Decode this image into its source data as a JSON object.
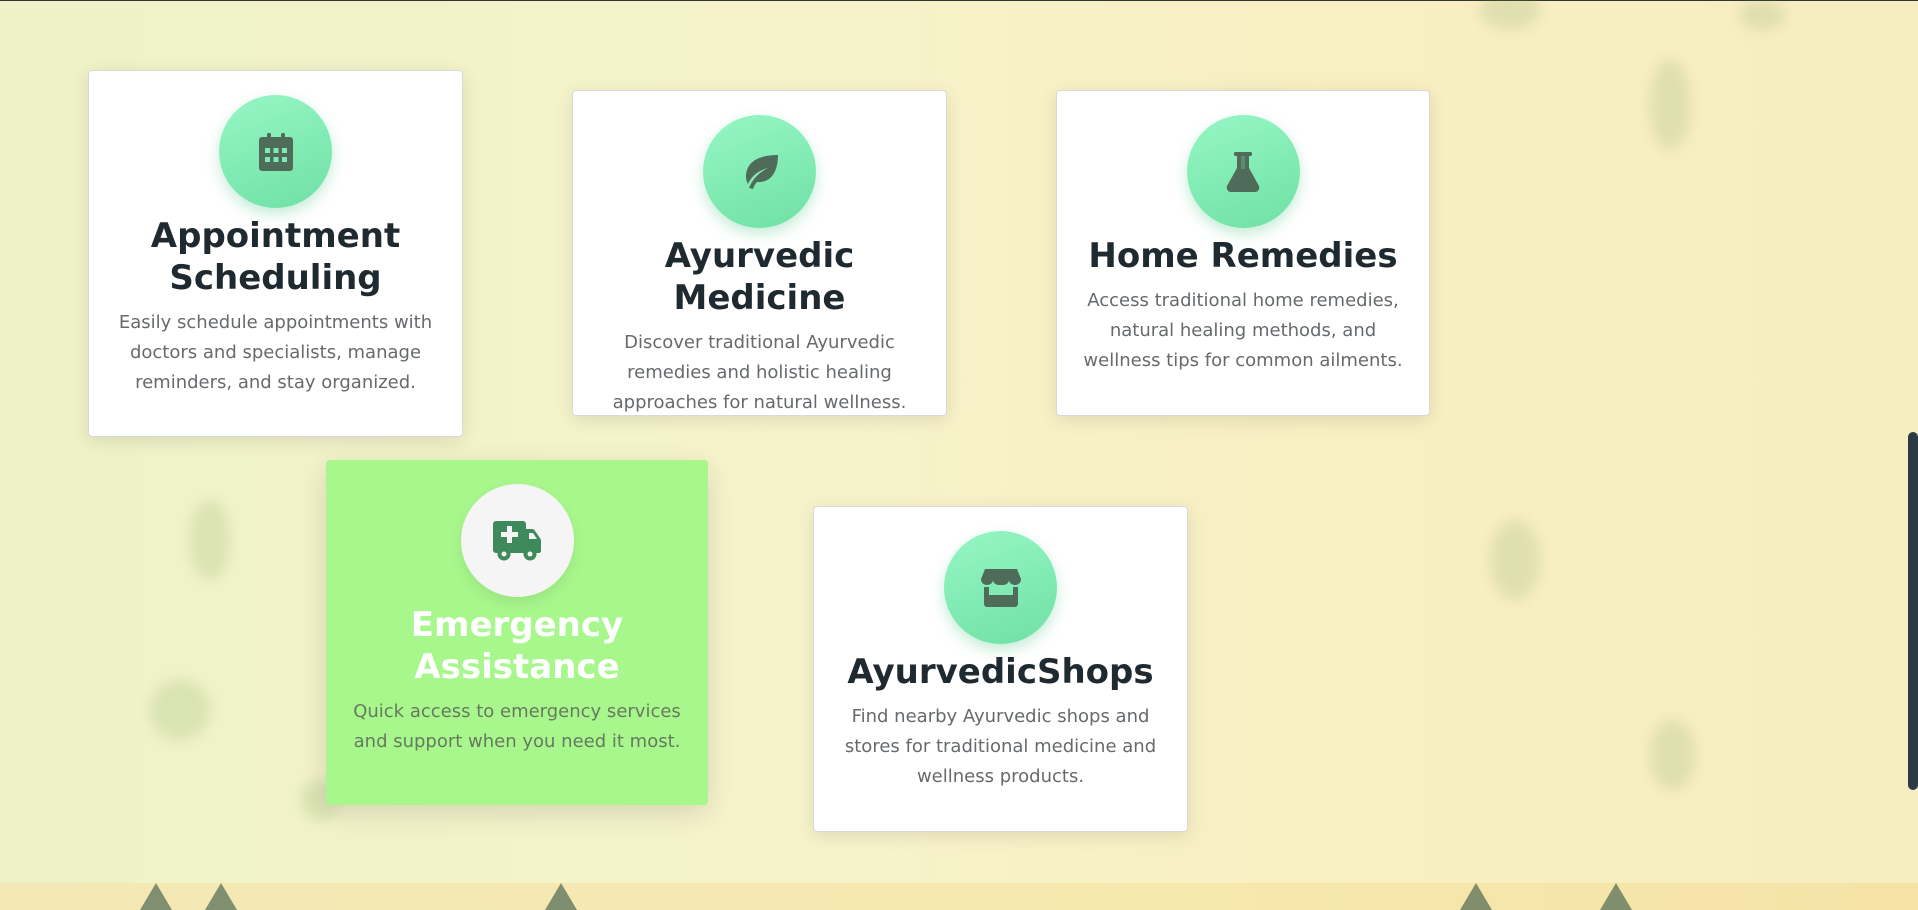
{
  "cards": [
    {
      "title": "Appointment Scheduling",
      "description": "Easily schedule appointments with doctors and specialists, manage reminders, and stay organized.",
      "icon": "calendar-icon",
      "active": false
    },
    {
      "title": "Ayurvedic Medicine",
      "description": "Discover traditional Ayurvedic remedies and holistic healing approaches for natural wellness.",
      "icon": "leaf-icon",
      "active": false
    },
    {
      "title": "Home Remedies",
      "description": "Access traditional home remedies, natural healing methods, and wellness tips for common ailments.",
      "icon": "flask-icon",
      "active": false
    },
    {
      "title": "Emergency Assistance",
      "description": "Quick access to emergency services and support when you need it most.",
      "icon": "ambulance-icon",
      "active": true
    },
    {
      "title": "AyurvedicShops",
      "description": "Find nearby Ayurvedic shops and stores for traditional medicine and wellness products.",
      "icon": "store-icon",
      "active": false
    }
  ],
  "colors": {
    "icon_circle": "#7eebb4",
    "active_card": "#a8f78c",
    "icon_glyph": "#4f6b5a",
    "active_icon_glyph": "#3f8a5a"
  }
}
